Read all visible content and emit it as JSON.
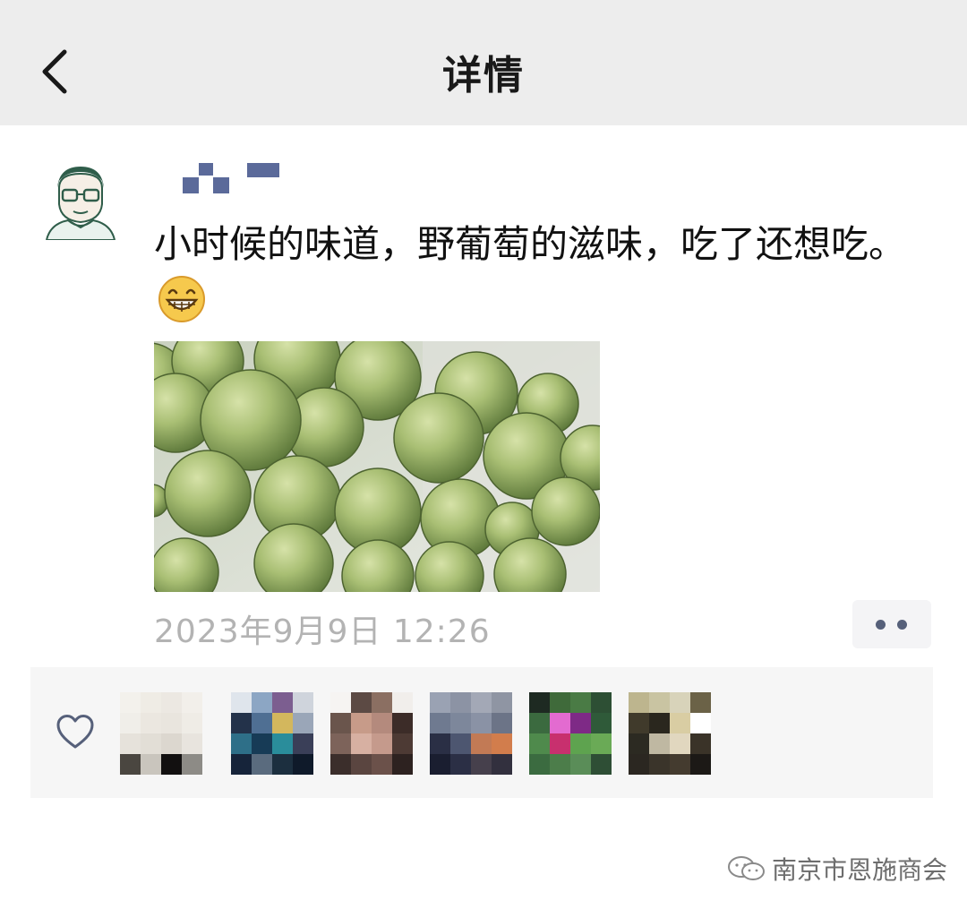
{
  "header": {
    "title": "详情",
    "back_icon": "chevron-left-icon"
  },
  "post": {
    "author_avatar_icon": "cartoon-man-avatar",
    "author_name_pixelated": true,
    "text": "小时候的味道，野葡萄的滋味，吃了还想吃。",
    "emoji": "grinning-face-emoji",
    "photo_subject": "green grapes",
    "timestamp": "2023年9月9日 12:26",
    "more_icon": "more-dots-icon"
  },
  "likes": {
    "icon": "heart-outline-icon",
    "likers": [
      {
        "colors": [
          "#f3f1ec",
          "#efece5",
          "#ece8e2",
          "#f2efea",
          "#f0eee9",
          "#ebe7e0",
          "#e9e5de",
          "#efece6",
          "#e6e2db",
          "#e2ded6",
          "#dcd7cf",
          "#e8e4de",
          "#4a4640",
          "#c9c5bd",
          "#121010",
          "#8d8b86"
        ]
      },
      {
        "colors": [
          "#dfe5ec",
          "#8ca6c4",
          "#7c5e90",
          "#cfd4dc",
          "#23324a",
          "#4f6f93",
          "#d3b75d",
          "#9aa6b8",
          "#2e6f88",
          "#173b56",
          "#2a8d9b",
          "#3a3f58",
          "#16243a",
          "#5a6b7e",
          "#1c2f3f",
          "#0f1a2a"
        ]
      },
      {
        "colors": [
          "#f6f4f2",
          "#5c4a44",
          "#8b6f62",
          "#f1eeeb",
          "#6a554c",
          "#c79b89",
          "#b48a7d",
          "#3c2c28",
          "#7d635a",
          "#d7b0a2",
          "#c59a8c",
          "#4d3a34",
          "#3b2e2b",
          "#5a4540",
          "#6b514a",
          "#2d2220"
        ]
      },
      {
        "colors": [
          "#9aa2b3",
          "#8c93a4",
          "#a3a8b6",
          "#8f95a3",
          "#6f7a90",
          "#7d879b",
          "#8a92a5",
          "#6c7487",
          "#2a2f45",
          "#4d5670",
          "#c27a55",
          "#d27d4c",
          "#1a1e30",
          "#2b2f45",
          "#46404c",
          "#32303e"
        ]
      },
      {
        "colors": [
          "#1e2a22",
          "#3f6a3a",
          "#4a7b45",
          "#2d4f34",
          "#3b6a3f",
          "#e36bd0",
          "#7e2a86",
          "#2f5a39",
          "#4f8a4c",
          "#c8306e",
          "#5ea34f",
          "#6aaa56",
          "#3b6b40",
          "#4c7d4a",
          "#5a8d58",
          "#2e4e35"
        ]
      },
      {
        "colors": [
          "#bdb58e",
          "#c9c4a2",
          "#d8d3ba",
          "#6b6247",
          "#403a2b",
          "#2a271e",
          "#d9cda3",
          "#ffffff",
          "#2c2a22",
          "#bfb8a2",
          "#e1d7bf",
          "#3a3328",
          "#2b2721",
          "#3a342a",
          "#443b2f",
          "#1c1916"
        ]
      }
    ]
  },
  "watermark": {
    "text": "南京市恩施商会",
    "icon": "wechat-official-account-icon"
  }
}
